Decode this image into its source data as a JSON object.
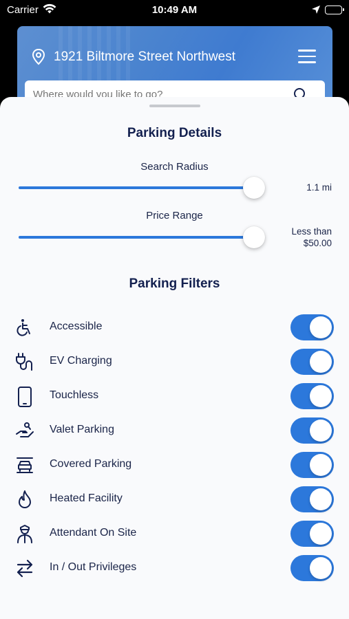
{
  "status_bar": {
    "carrier": "Carrier",
    "time": "10:49 AM"
  },
  "header": {
    "address": "1921 Biltmore Street Northwest",
    "search_placeholder": "Where would you like to go?"
  },
  "details": {
    "title": "Parking Details",
    "search_radius": {
      "label": "Search Radius",
      "value": "1.1 mi",
      "level": 1.0
    },
    "price_range": {
      "label": "Price Range",
      "value_line1": "Less than",
      "value_line2": "$50.00",
      "level": 1.0
    }
  },
  "filters": {
    "title": "Parking Filters",
    "items": [
      {
        "label": "Accessible",
        "icon": "wheelchair-icon",
        "enabled": true
      },
      {
        "label": "EV Charging",
        "icon": "ev-plug-icon",
        "enabled": true
      },
      {
        "label": "Touchless",
        "icon": "phone-icon",
        "enabled": true
      },
      {
        "label": "Valet Parking",
        "icon": "valet-hand-icon",
        "enabled": true
      },
      {
        "label": "Covered Parking",
        "icon": "covered-car-icon",
        "enabled": true
      },
      {
        "label": "Heated Facility",
        "icon": "flame-icon",
        "enabled": true
      },
      {
        "label": "Attendant On Site",
        "icon": "attendant-icon",
        "enabled": true
      },
      {
        "label": "In / Out Privileges",
        "icon": "in-out-arrows-icon",
        "enabled": true
      }
    ]
  },
  "colors": {
    "accent": "#2c78db",
    "title_text": "#13204f",
    "sheet_background": "#f9fafc"
  }
}
